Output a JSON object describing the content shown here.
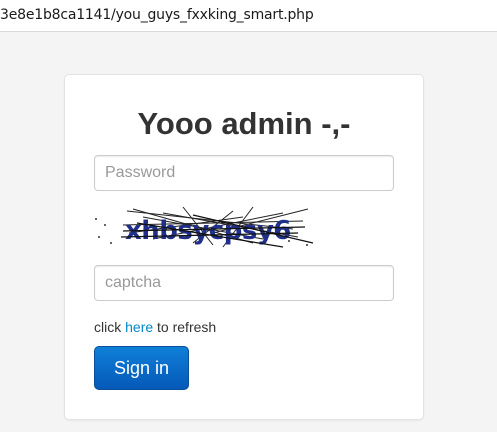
{
  "browser": {
    "url": "3e8e1b8ca1141/you_guys_fxxking_smart.php"
  },
  "login": {
    "title": "Yooo admin -,-",
    "password_placeholder": "Password",
    "captcha_text": "xhbsycpsy6",
    "captcha_placeholder": "captcha",
    "refresh_prefix": "click ",
    "refresh_link": "here",
    "refresh_suffix": " to refresh",
    "signin_label": "Sign in"
  },
  "colors": {
    "page_background": "#f4f4f4",
    "link": "#0088cc",
    "button": "#0559b8",
    "captcha_text": "#1f2f8a"
  }
}
